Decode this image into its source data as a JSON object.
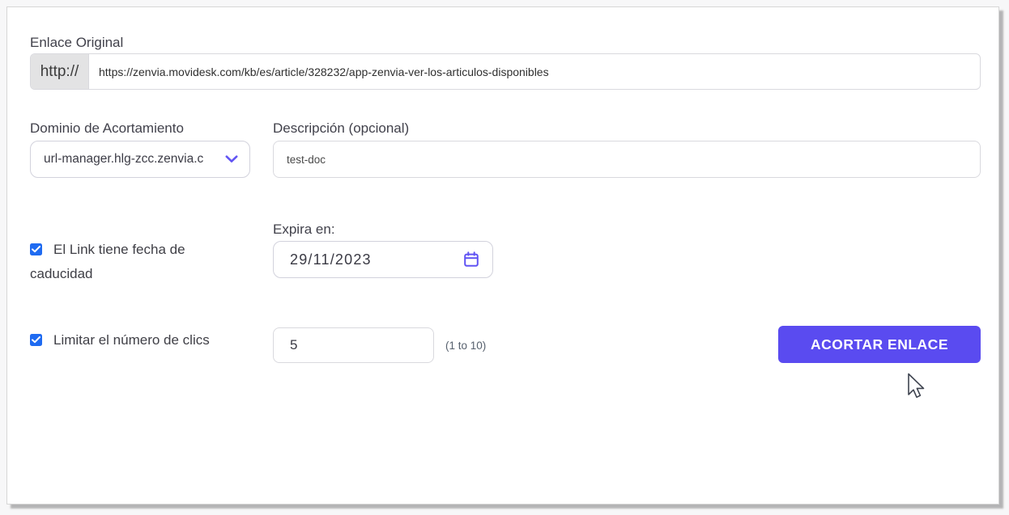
{
  "colors": {
    "accent_purple": "#5a4bf0",
    "icon_purple": "#6154f3",
    "checkbox_blue": "#1f6bf1"
  },
  "form": {
    "original_link": {
      "label": "Enlace Original",
      "prefix": "http://",
      "value": "https://zenvia.movidesk.com/kb/es/article/328232/app-zenvia-ver-los-articulos-disponibles"
    },
    "domain": {
      "label": "Dominio de Acortamiento",
      "selected": "url-manager.hlg-zcc.zenvia.c",
      "icon": "chevron-down-icon"
    },
    "description": {
      "label": "Descripción (opcional)",
      "value": "test-doc"
    },
    "expiry": {
      "checkbox_label": "El Link tiene fecha de caducidad",
      "checked": true,
      "date_label": "Expira en:",
      "date_value": "29/11/2023",
      "icon": "calendar-icon"
    },
    "click_limit": {
      "checkbox_label": "Limitar el número de clics",
      "checked": true,
      "value": "5",
      "hint": "(1 to 10)"
    },
    "submit_label": "ACORTAR ENLACE"
  },
  "pointer": {
    "icon": "cursor-arrow-icon"
  }
}
